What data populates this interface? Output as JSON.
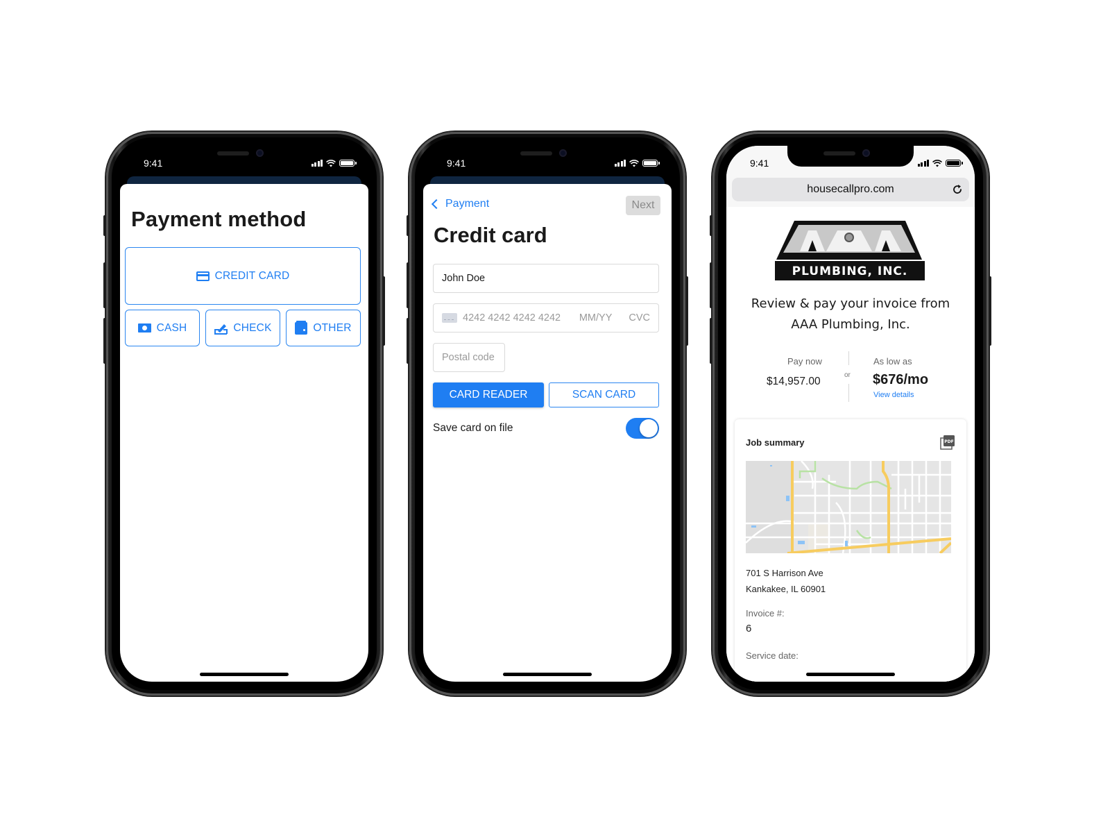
{
  "status_bar": {
    "time": "9:41"
  },
  "screen1": {
    "title": "Payment method",
    "options": [
      {
        "label": "CREDIT CARD",
        "icon": "credit-card-icon"
      },
      {
        "label": "CASH",
        "icon": "cash-icon"
      },
      {
        "label": "CHECK",
        "icon": "check-icon"
      },
      {
        "label": "OTHER",
        "icon": "wallet-icon"
      }
    ]
  },
  "screen2": {
    "back_label": "Payment",
    "next_label": "Next",
    "title": "Credit card",
    "name_value": "John Doe",
    "card_number_placeholder": "4242 4242 4242 4242",
    "expiry_placeholder": "MM/YY",
    "cvc_placeholder": "CVC",
    "postal_placeholder": "Postal code",
    "card_reader_label": "CARD READER",
    "scan_card_label": "SCAN CARD",
    "save_card_label": "Save card on file",
    "save_card_on": true
  },
  "screen3": {
    "url": "housecallpro.com",
    "logo_text_top": "AAA",
    "logo_text_bottom": "PLUMBING, INC.",
    "heading_line1": "Review & pay your invoice from",
    "heading_line2": "AAA Plumbing, Inc.",
    "pay_now_label": "Pay now",
    "pay_now_amount": "$14,957.00",
    "or_label": "or",
    "as_low_as_label": "As low as",
    "monthly_amount": "$676/mo",
    "view_details_label": "View details",
    "job_summary_title": "Job summary",
    "pdf_icon_label": "PDF",
    "address_line1": "701 S Harrison Ave",
    "address_line2": "Kankakee, IL 60901",
    "invoice_label": "Invoice #:",
    "invoice_value": "6",
    "service_date_label": "Service date:"
  },
  "colors": {
    "accent": "#1f7ef2",
    "sheet_backdrop": "#0f2540",
    "disabled_button": "#dcdcdc",
    "map_highway": "#f7cc5f",
    "map_park": "#b8e2a4",
    "map_water": "#8dc3f6"
  }
}
